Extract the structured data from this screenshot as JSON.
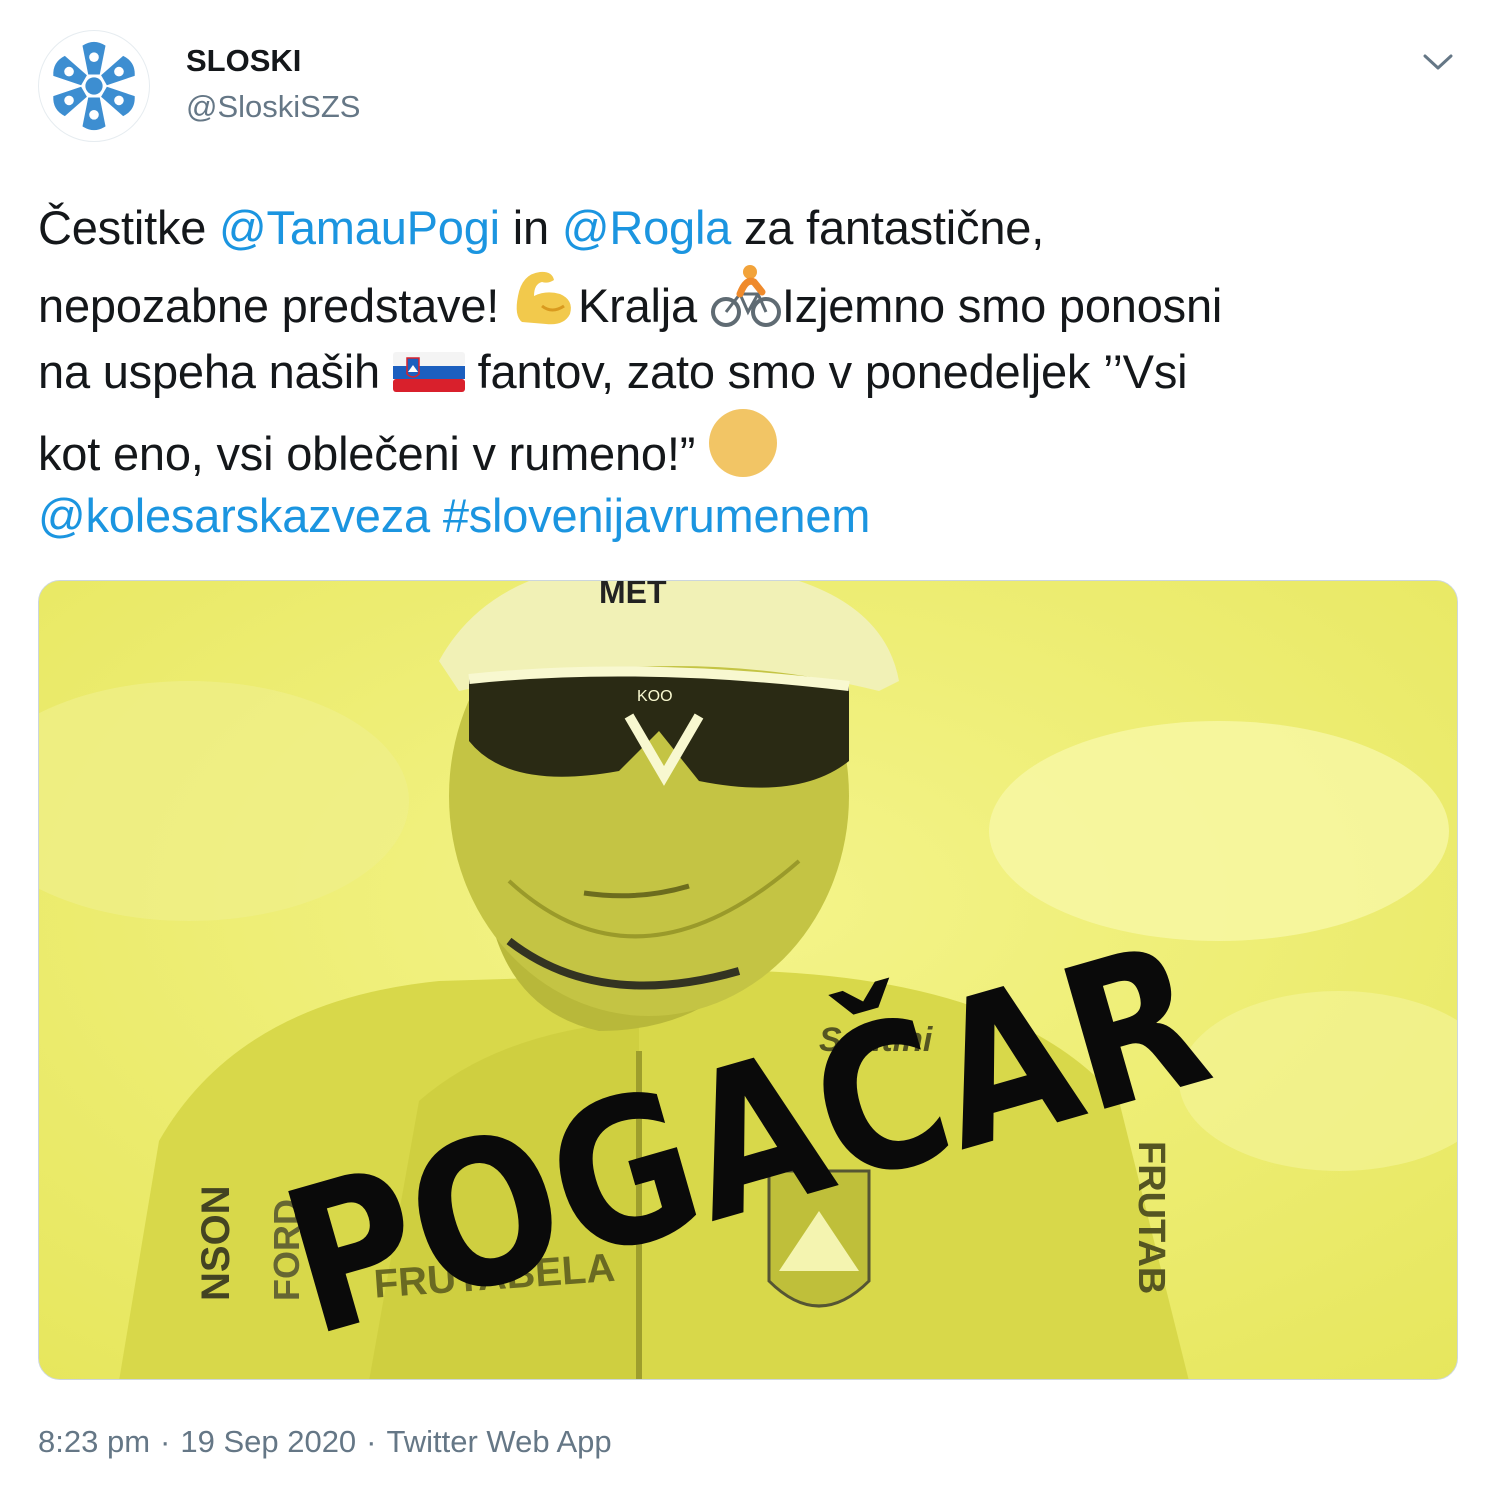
{
  "account": {
    "display_name": "SLOSKI",
    "handle": "@SloskiSZS",
    "avatar_icon": "snowflake-logo-icon"
  },
  "menu": {
    "icon": "chevron-down-icon"
  },
  "tweet": {
    "line1": {
      "a": "Čestitke ",
      "mention1": "@TamauPogi",
      "b": " in ",
      "mention2": "@Rogla",
      "c": " za fantastične,"
    },
    "line2": {
      "a": "nepozabne predstave! ",
      "emoji1": "flexed-biceps-emoji",
      "b": "Kralja ",
      "emoji2": "person-biking-emoji",
      "c": "Izjemno smo ponosni"
    },
    "line3": {
      "a": "na uspeha naših ",
      "emoji3": "slovenia-flag-emoji",
      "b": " fantov, zato smo v ponedeljek ’’Vsi"
    },
    "line4": {
      "a": "kot eno, vsi oblečeni v rumeno!” ",
      "emoji4": "yellow-circle-emoji"
    },
    "line5": {
      "mention3": "@kolesarskazveza",
      "space": " ",
      "hashtag": "#slovenijavrumenem"
    }
  },
  "media": {
    "overlay_text": "POGAČAR",
    "helmet_text": "MET",
    "glasses_text": "KOO",
    "jersey_text": "FRUTABELA",
    "jersey_text_right": "FRUTAB",
    "sleeve_text": "NSON",
    "sleeve_text2": "FORD",
    "collar_text": "Santini",
    "tint_color": "#eeee66"
  },
  "footer": {
    "time": "8:23 pm",
    "separator": "·",
    "date": "19 Sep 2020",
    "source": "Twitter Web App"
  },
  "colors": {
    "link": "#1b95e0",
    "text": "#14171a",
    "secondary": "#657786",
    "border": "#ccd6dd"
  }
}
